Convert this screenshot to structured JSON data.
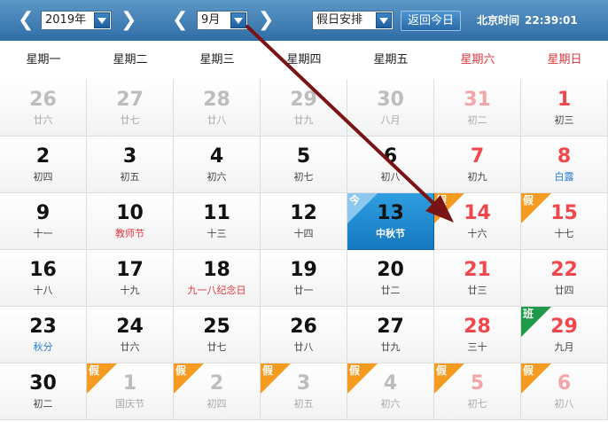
{
  "toolbar": {
    "year_value": "2019年",
    "month_value": "9月",
    "holiday_select": "假日安排",
    "today_button": "返回今日",
    "clock_label": "北京时间",
    "clock_time": "22:39:01",
    "prev_arrow": "❮",
    "next_arrow": "❯"
  },
  "weekdays": [
    "星期一",
    "星期二",
    "星期三",
    "星期四",
    "星期五",
    "星期六",
    "星期日"
  ],
  "weeks": [
    [
      {
        "day": "26",
        "sub": "廿六",
        "other": true
      },
      {
        "day": "27",
        "sub": "廿七",
        "other": true
      },
      {
        "day": "28",
        "sub": "廿八",
        "other": true
      },
      {
        "day": "29",
        "sub": "廿九",
        "other": true
      },
      {
        "day": "30",
        "sub": "八月",
        "other": true
      },
      {
        "day": "31",
        "sub": "初二",
        "other": true
      },
      {
        "day": "1",
        "sub": "初三"
      }
    ],
    [
      {
        "day": "2",
        "sub": "初四"
      },
      {
        "day": "3",
        "sub": "初五"
      },
      {
        "day": "4",
        "sub": "初六"
      },
      {
        "day": "5",
        "sub": "初七"
      },
      {
        "day": "6",
        "sub": "初八"
      },
      {
        "day": "7",
        "sub": "初九"
      },
      {
        "day": "8",
        "sub": "白露",
        "subtype": "term"
      }
    ],
    [
      {
        "day": "9",
        "sub": "十一"
      },
      {
        "day": "10",
        "sub": "教师节",
        "subtype": "festival"
      },
      {
        "day": "11",
        "sub": "十三"
      },
      {
        "day": "12",
        "sub": "十四"
      },
      {
        "day": "13",
        "sub": "中秋节",
        "today": true,
        "badge": "今",
        "badgetype": "jin"
      },
      {
        "day": "14",
        "sub": "十六",
        "badge": "假"
      },
      {
        "day": "15",
        "sub": "十七",
        "badge": "假"
      }
    ],
    [
      {
        "day": "16",
        "sub": "十八"
      },
      {
        "day": "17",
        "sub": "十九"
      },
      {
        "day": "18",
        "sub": "九一八纪念日",
        "subtype": "festival"
      },
      {
        "day": "19",
        "sub": "廿一"
      },
      {
        "day": "20",
        "sub": "廿二"
      },
      {
        "day": "21",
        "sub": "廿三"
      },
      {
        "day": "22",
        "sub": "廿四"
      }
    ],
    [
      {
        "day": "23",
        "sub": "秋分",
        "subtype": "term"
      },
      {
        "day": "24",
        "sub": "廿六"
      },
      {
        "day": "25",
        "sub": "廿七"
      },
      {
        "day": "26",
        "sub": "廿八"
      },
      {
        "day": "27",
        "sub": "廿九"
      },
      {
        "day": "28",
        "sub": "三十"
      },
      {
        "day": "29",
        "sub": "九月",
        "badge": "班",
        "badgetype": "ban"
      }
    ],
    [
      {
        "day": "30",
        "sub": "初二"
      },
      {
        "day": "1",
        "sub": "国庆节",
        "other": true,
        "badge": "假"
      },
      {
        "day": "2",
        "sub": "初四",
        "other": true,
        "badge": "假"
      },
      {
        "day": "3",
        "sub": "初五",
        "other": true,
        "badge": "假"
      },
      {
        "day": "4",
        "sub": "初六",
        "other": true,
        "badge": "假"
      },
      {
        "day": "5",
        "sub": "初七",
        "other": true,
        "badge": "假"
      },
      {
        "day": "6",
        "sub": "初八",
        "other": true,
        "badge": "假"
      }
    ]
  ],
  "colors": {
    "toolbar": "#3f7fb6",
    "weekend_text": "#e0383d",
    "holiday_badge": "#f59b20",
    "workday_badge": "#1f9a4a",
    "today_cell": "#1a86cc",
    "annotation_arrow": "#7a1414"
  }
}
